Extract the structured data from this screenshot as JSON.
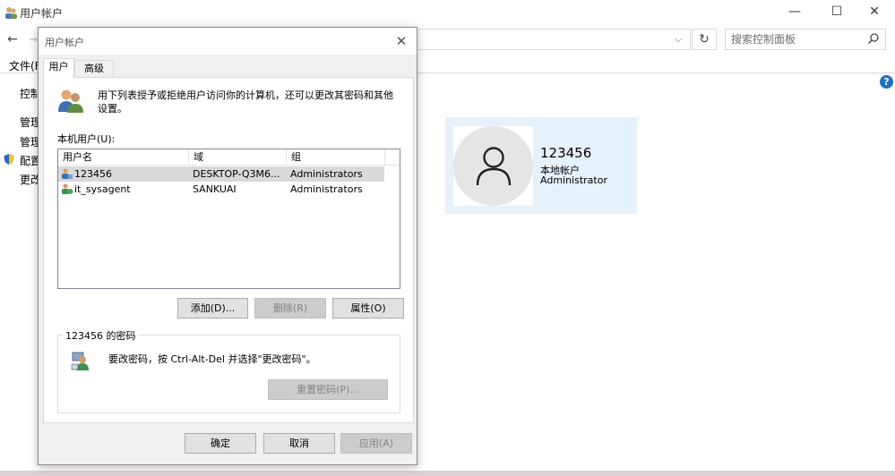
{
  "window": {
    "title": "用户帐户",
    "minimize": "—",
    "maximize": "☐",
    "close": "✕",
    "back": "←",
    "forward": "→",
    "address_dropdown": "⌵",
    "refresh": "↻",
    "search_placeholder": "搜索控制面板",
    "menu_file": "文件(F)"
  },
  "left_links": [
    "控制",
    "管理",
    "管理",
    "配置",
    "更改"
  ],
  "help": "?",
  "user_tile": {
    "name": "123456",
    "type": "本地帐户",
    "role": "Administrator"
  },
  "dialog": {
    "title": "用户帐户",
    "close": "✕",
    "tabs": [
      "用户",
      "高级"
    ],
    "intro": "用下列表授予或拒绝用户访问你的计算机，还可以更改其密码和其他设置。",
    "local_users_label": "本机用户(U):",
    "columns": [
      "用户名",
      "域",
      "组"
    ],
    "users": [
      {
        "name": "123456",
        "domain": "DESKTOP-Q3M6...",
        "group": "Administrators",
        "selected": true
      },
      {
        "name": "it_sysagent",
        "domain": "SANKUAI",
        "group": "Administrators",
        "selected": false
      }
    ],
    "buttons": {
      "add": "添加(D)...",
      "remove": "删除(R)",
      "properties": "属性(O)",
      "reset_password": "重置密码(P)...",
      "ok": "确定",
      "cancel": "取消",
      "apply": "应用(A)"
    },
    "password_group": {
      "legend": "123456 的密码",
      "text": "要改密码，按 Ctrl-Alt-Del 并选择\"更改密码\"。"
    }
  },
  "colors": {
    "tile_bg": "#e5f1fb",
    "help_blue": "#1d6fc9",
    "selected_row": "#d9d9d9"
  }
}
